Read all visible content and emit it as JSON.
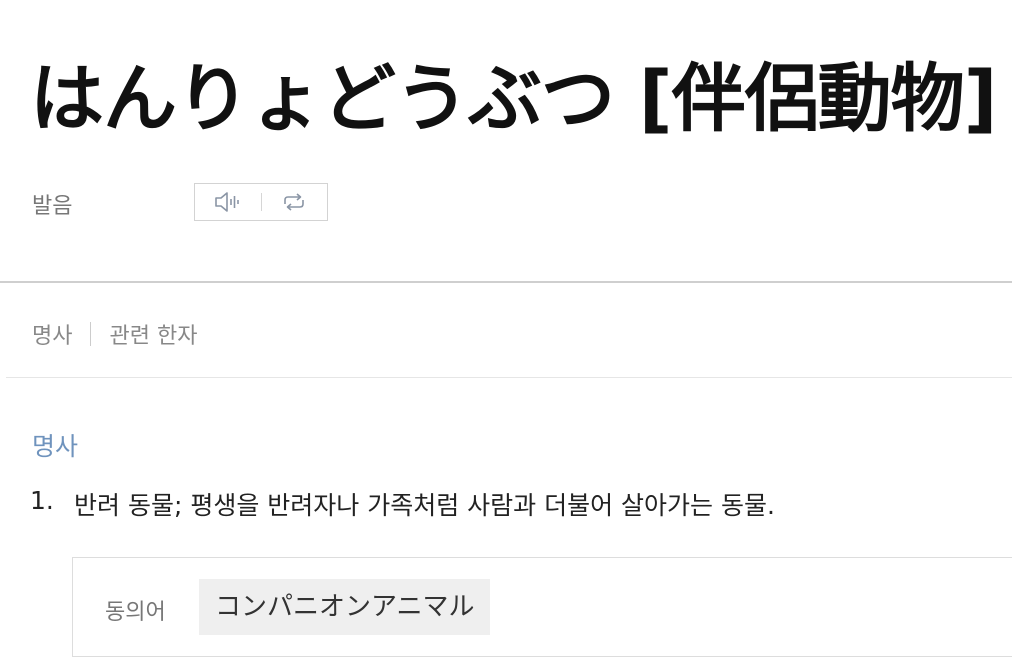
{
  "entry": {
    "title": "はんりょどうぶつ [伴侶動物]"
  },
  "pronunciation": {
    "label": "발음",
    "play_icon": "speaker-icon",
    "repeat_icon": "repeat-icon"
  },
  "tabs": [
    {
      "label": "명사"
    },
    {
      "label": "관련 한자"
    }
  ],
  "definition": {
    "part_of_speech": "명사",
    "senses": [
      {
        "number": "1.",
        "text": "반려 동물; 평생을 반려자나 가족처럼 사람과 더불어 살아가는 동물."
      }
    ]
  },
  "synonym": {
    "label": "동의어",
    "value": "コンパニオンアニマル"
  },
  "colors": {
    "pos_heading": "#6f93bd",
    "icon_gray": "#8a95a5"
  }
}
